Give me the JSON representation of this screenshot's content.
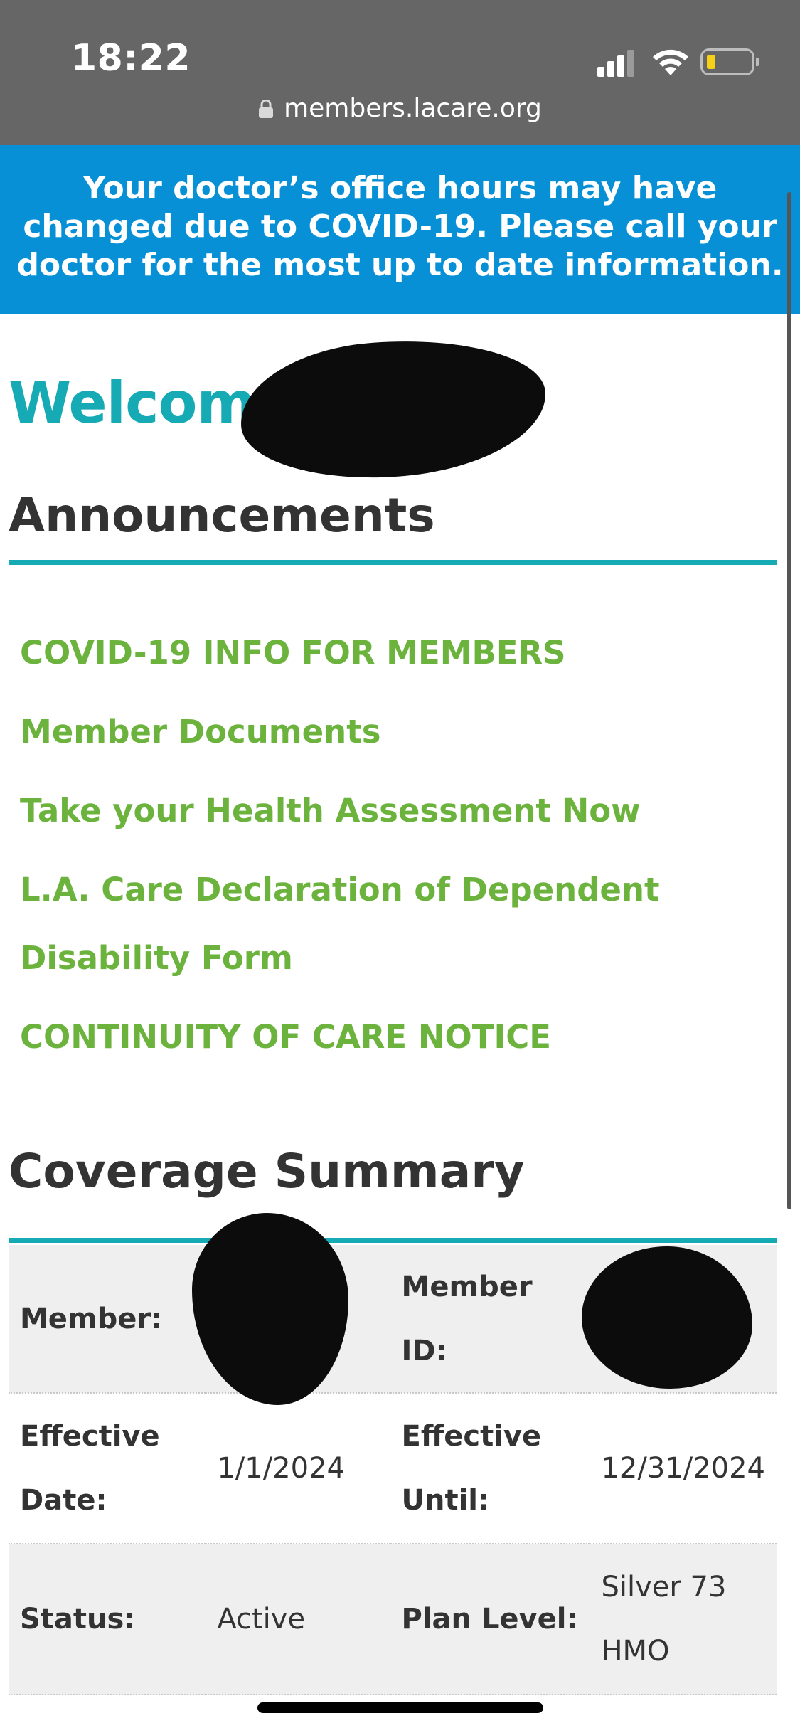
{
  "status_bar": {
    "time": "18:22",
    "url": "members.lacare.org"
  },
  "banner": {
    "text": "Your doctor’s office hours may have changed due to COVID-19. Please call your doctor for the most up to date information."
  },
  "welcome": {
    "text": "Welcome, L"
  },
  "announcements": {
    "heading": "Announcements",
    "items": [
      {
        "label": "COVID-19 INFO FOR MEMBERS"
      },
      {
        "label": "Member Documents"
      },
      {
        "label": "Take your Health Assessment Now"
      },
      {
        "label": "L.A. Care Declaration of Dependent Disability Form"
      },
      {
        "label": "CONTINUITY OF CARE NOTICE"
      }
    ]
  },
  "coverage": {
    "heading": "Coverage Summary",
    "rows": [
      {
        "l1": "Member:",
        "v1": "",
        "l2": "Member ID:",
        "v2": ""
      },
      {
        "l1": "Effective Date:",
        "v1": "1/1/2024",
        "l2": "Effective Until:",
        "v2": "12/31/2024"
      },
      {
        "l1": "Status:",
        "v1": "Active",
        "l2": "Plan Level:",
        "v2": "Silver 73 HMO"
      }
    ]
  },
  "colors": {
    "banner": "#0790d6",
    "accent": "#15aab4",
    "link": "#6cb33e"
  }
}
